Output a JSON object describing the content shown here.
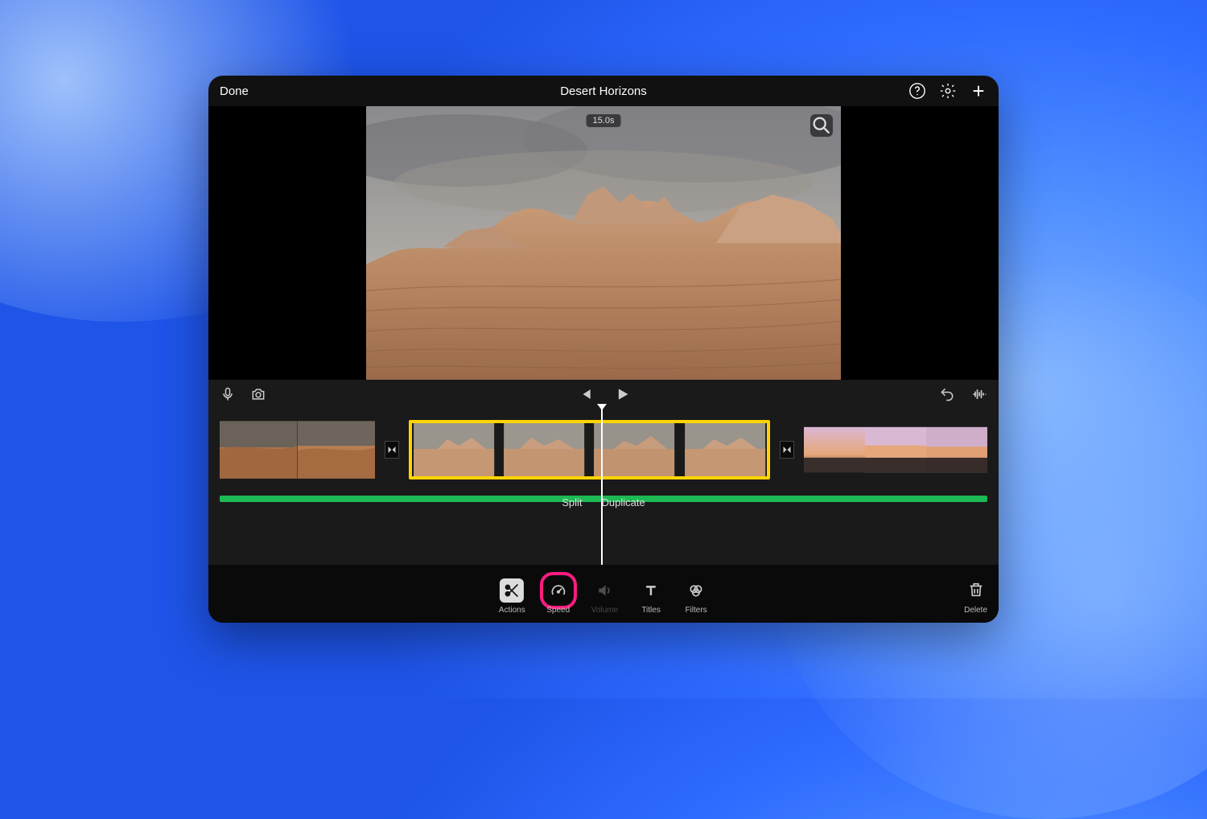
{
  "header": {
    "done_label": "Done",
    "project_title": "Desert Horizons"
  },
  "preview": {
    "duration_label": "15.0s"
  },
  "clip_menu": {
    "split_label": "Split",
    "duplicate_label": "Duplicate"
  },
  "tools": {
    "actions_label": "Actions",
    "speed_label": "Speed",
    "volume_label": "Volume",
    "titles_label": "Titles",
    "filters_label": "Filters",
    "delete_label": "Delete"
  },
  "icons": {
    "help": "help-circle-icon",
    "settings": "gear-icon",
    "add": "plus-icon",
    "zoom": "magnifier-icon",
    "voiceover": "microphone-icon",
    "camera": "camera-icon",
    "prev": "skip-back-icon",
    "play": "play-icon",
    "undo": "undo-icon",
    "waveform": "waveform-icon",
    "transition": "transition-icon",
    "scissors": "scissors-icon",
    "speed": "speedometer-icon",
    "volume": "speaker-icon",
    "titles": "text-icon",
    "filters": "overlap-circles-icon",
    "trash": "trash-icon"
  }
}
